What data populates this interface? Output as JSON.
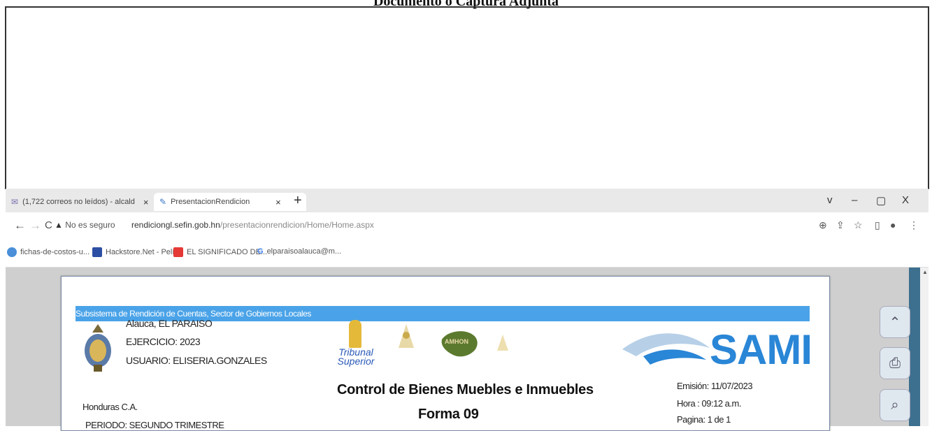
{
  "document_heading": "Documento o Captura Adjunta",
  "browser": {
    "tabs": [
      {
        "icon": "mail-icon",
        "label": "(1,722 correos no leídos) - alcald",
        "close": "×"
      },
      {
        "icon": "rendicion-icon",
        "label": "PresentacionRendicion",
        "close": "×"
      }
    ],
    "new_tab": "+",
    "window_controls": [
      "v",
      "–",
      "▢",
      "X"
    ],
    "nav": {
      "back": "←",
      "forward": "→",
      "reload": "C"
    },
    "security_label": "No es seguro",
    "url_host": "rendiciongl.sefin.gob.hn",
    "url_path": "/presentacionrendicion/Home/Home.aspx",
    "toolbar_icons": [
      "zoom-icon",
      "share-icon",
      "star-icon",
      "sidepanel-icon",
      "profile-icon",
      "menu-icon"
    ],
    "bookmarks": [
      {
        "label": "fichas-de-costos-u...",
        "color": "#4a8fd8"
      },
      {
        "label": "Hackstore.Net - Pelí...",
        "color": "#2d4fa3"
      },
      {
        "label": "EL SIGNIFICADO DE...",
        "color": "#e53935"
      },
      {
        "label": "elparaisoalauca@m...",
        "color": "#4285f4"
      }
    ]
  },
  "report": {
    "subsystem_title": "Subsistema de Rendición de Cuentas, Sector de Gobiernos Locales",
    "municipality": "Alauca, EL PARAISO",
    "exercise": "EJERCICIO: 2023",
    "user": "USUARIO: ELISERIA.GONZALES",
    "country": "Honduras C.A.",
    "period": "PERIODO: SEGUNDO TRIMESTRE",
    "tribunal_logo_text": "Tribunal Superior",
    "amhon_logo_text": "AMHON",
    "sami_logo_text": "SAMI",
    "heading": "Control de Bienes Muebles e Inmuebles",
    "form": "Forma 09",
    "emission": "Emisión:  11/07/2023",
    "time": "Hora :     09:12 a.m.",
    "page": "Pagina: 1 de 1"
  },
  "colors": {
    "accent": "#4aa3e8",
    "sami": "#2a86d6",
    "amhon": "#5c7a2e"
  }
}
